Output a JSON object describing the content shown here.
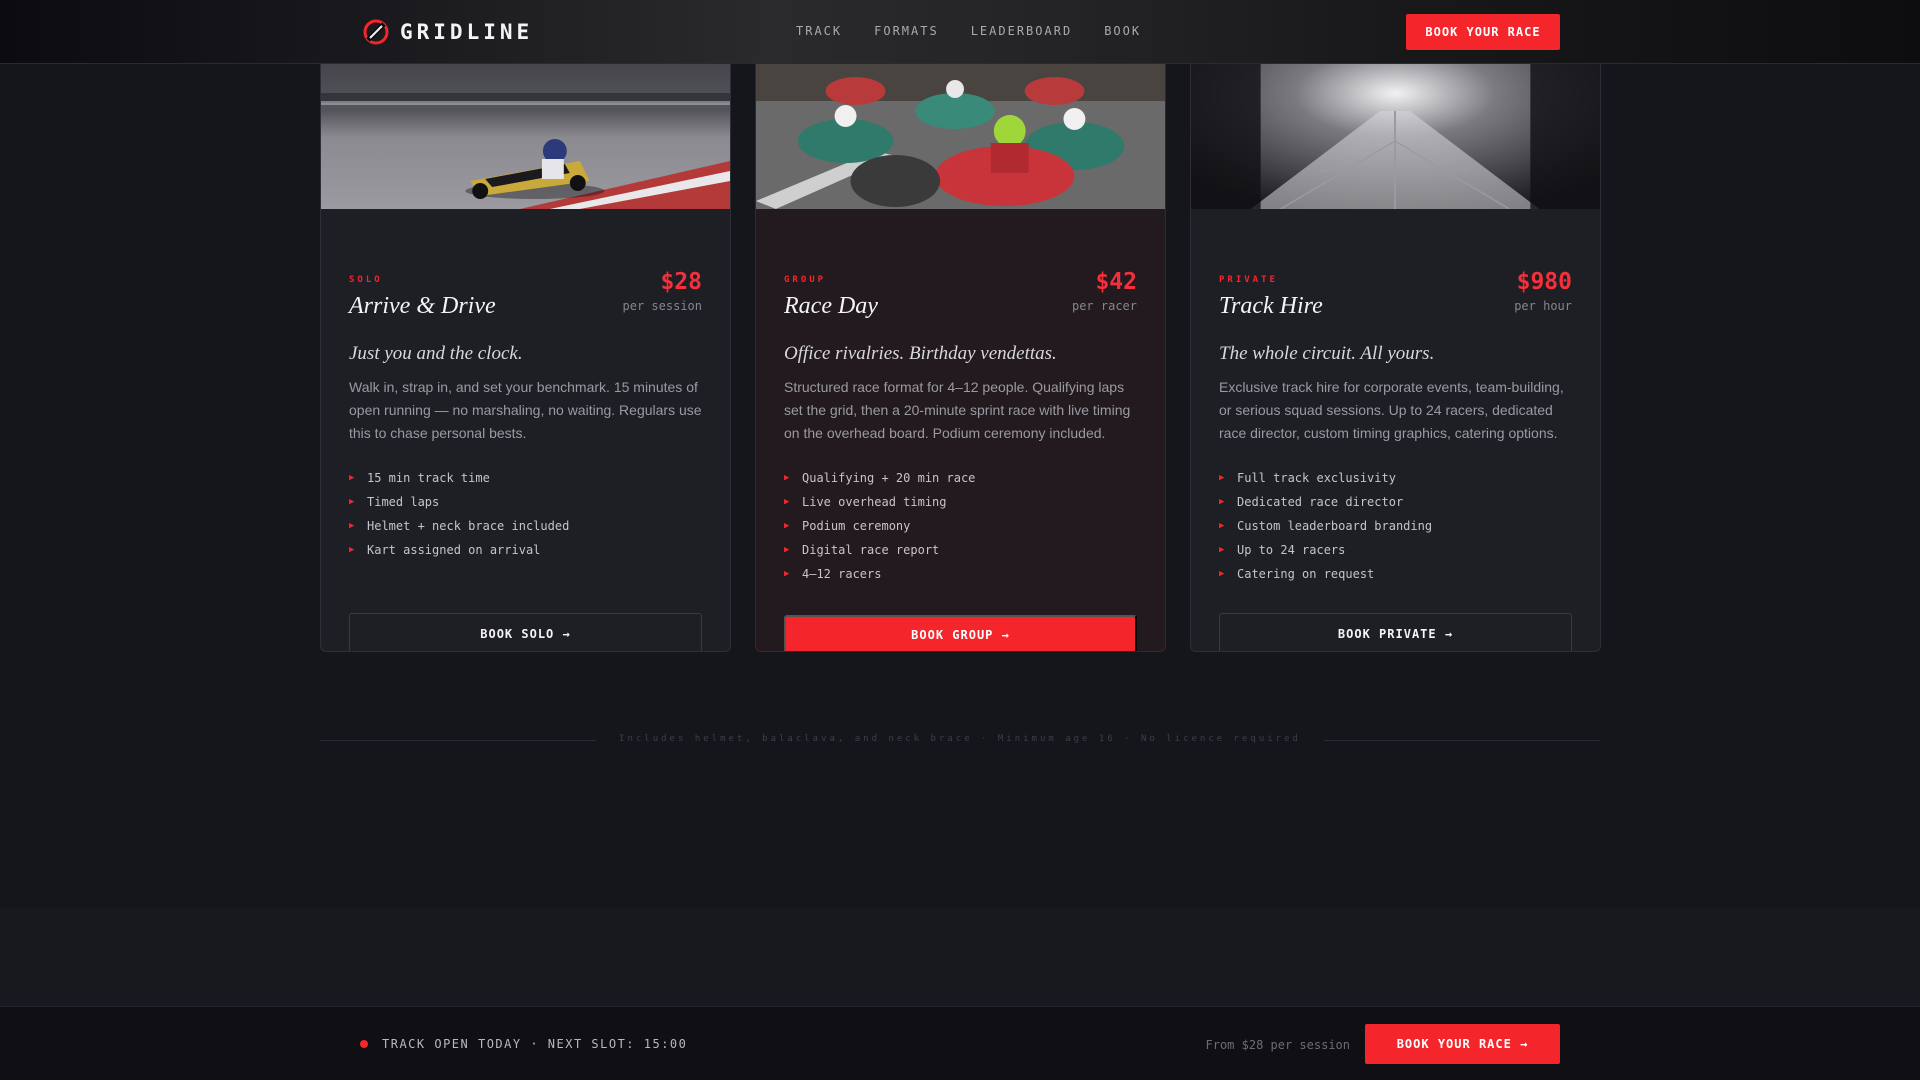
{
  "header": {
    "brand": "GRIDLINE",
    "nav": [
      "TRACK",
      "FORMATS",
      "LEADERBOARD",
      "BOOK"
    ],
    "cta": "BOOK YOUR RACE"
  },
  "cards": [
    {
      "tag": "SOLO",
      "title": "Arrive & Drive",
      "price": "$28",
      "unit": "per session",
      "tagline": "Just you and the clock.",
      "description": "Walk in, strap in, and set your benchmark. 15 minutes of open running — no marshaling, no waiting. Regulars use this to chase personal bests.",
      "features": [
        "15 min track time",
        "Timed laps",
        "Helmet + neck brace included",
        "Kart assigned on arrival"
      ],
      "button": "BOOK SOLO →"
    },
    {
      "tag": "GROUP",
      "title": "Race Day",
      "price": "$42",
      "unit": "per racer",
      "tagline": "Office rivalries. Birthday vendettas.",
      "description": "Structured race format for 4–12 people. Qualifying laps set the grid, then a 20-minute sprint race with live timing on the overhead board. Podium ceremony included.",
      "features": [
        "Qualifying + 20 min race",
        "Live overhead timing",
        "Podium ceremony",
        "Digital race report",
        "4–12 racers"
      ],
      "button": "BOOK GROUP →"
    },
    {
      "tag": "PRIVATE",
      "title": "Track Hire",
      "price": "$980",
      "unit": "per hour",
      "tagline": "The whole circuit. All yours.",
      "description": "Exclusive track hire for corporate events, team-building, or serious squad sessions. Up to 24 racers, dedicated race director, custom timing graphics, catering options.",
      "features": [
        "Full track exclusivity",
        "Dedicated race director",
        "Custom leaderboard branding",
        "Up to 24 racers",
        "Catering on request"
      ],
      "button": "BOOK PRIVATE →"
    }
  ],
  "note": "Includes helmet, balaclava, and neck brace · Minimum age 16 · No licence required",
  "bottom_bar": {
    "status": "TRACK OPEN TODAY · NEXT SLOT: 15:00",
    "from": "From $28 per session",
    "cta": "BOOK YOUR RACE →"
  },
  "colors": {
    "accent": "#f5262b",
    "background": "#15151c",
    "card": "#1e1e25"
  },
  "icons": [
    "gridline-logo-icon",
    "triangle-bullet-icon",
    "status-dot-icon"
  ]
}
